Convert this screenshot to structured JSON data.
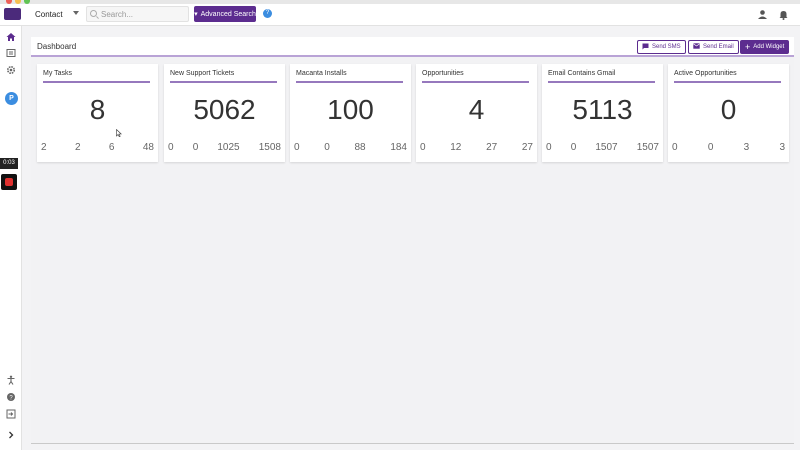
{
  "topbar": {
    "entity_select": "Contact",
    "search_placeholder": "Search...",
    "advanced_search_label": "Advanced Search",
    "help_glyph": "?"
  },
  "sidebar": {
    "avatar_initial": "P",
    "timer": "0:03"
  },
  "dashboard": {
    "title": "Dashboard",
    "send_sms_label": "Send SMS",
    "send_email_label": "Send Email",
    "add_widget_label": "Add Widget"
  },
  "widgets": [
    {
      "title": "My Tasks",
      "value": "8",
      "stats": [
        "2",
        "2",
        "6",
        "48"
      ]
    },
    {
      "title": "New Support Tickets",
      "value": "5062",
      "stats": [
        "0",
        "0",
        "1025",
        "1508"
      ]
    },
    {
      "title": "Macanta Installs",
      "value": "100",
      "stats": [
        "0",
        "0",
        "88",
        "184"
      ]
    },
    {
      "title": "Opportunities",
      "value": "4",
      "stats": [
        "0",
        "12",
        "27",
        "27"
      ]
    },
    {
      "title": "Email Contains Gmail",
      "value": "5113",
      "stats": [
        "0",
        "0",
        "1507",
        "1507"
      ]
    },
    {
      "title": "Active Opportunities",
      "value": "0",
      "stats": [
        "0",
        "0",
        "3",
        "3"
      ]
    }
  ],
  "colors": {
    "brand": "#5c2c8f",
    "accent_rule": "#9678bd",
    "avatar": "#3b8de0"
  },
  "icons": [
    "home-icon",
    "contacts-icon",
    "gear-icon",
    "accessibility-icon",
    "help-icon",
    "logout-icon",
    "expand-icon",
    "user-icon",
    "bell-icon",
    "search-icon",
    "sms-icon",
    "email-icon",
    "plus-icon"
  ]
}
